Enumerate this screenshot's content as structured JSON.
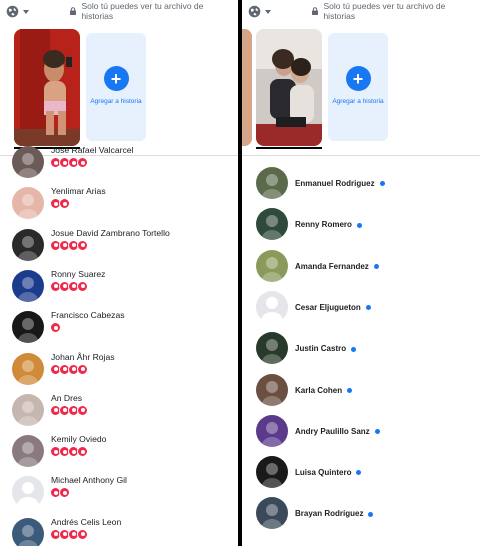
{
  "privacy_text": "Solo tú puedes ver tu archivo de historias",
  "add_story_label": "Agregar a historia",
  "colors": {
    "accent": "#1877f2",
    "reaction": "#f02849"
  },
  "left": {
    "viewers": [
      {
        "name": "Jose Rafael Valcarcel",
        "reactions": 4
      },
      {
        "name": "Yenlimar Arias",
        "reactions": 2
      },
      {
        "name": "Josue David Zambrano Tortello",
        "reactions": 4
      },
      {
        "name": "Ronny Suarez",
        "reactions": 4
      },
      {
        "name": "Francisco Cabezas",
        "reactions": 1
      },
      {
        "name": "Johan Åhr Rojas",
        "reactions": 4
      },
      {
        "name": "An Dres",
        "reactions": 4
      },
      {
        "name": "Kemily Oviedo",
        "reactions": 4
      },
      {
        "name": "Michael Anthony Gil",
        "reactions": 2
      },
      {
        "name": "Andrés Celis Leon",
        "reactions": 4
      }
    ]
  },
  "right": {
    "viewers": [
      {
        "name": "Enmanuel Rodriguez"
      },
      {
        "name": "Renny Romero"
      },
      {
        "name": "Amanda Fernandez"
      },
      {
        "name": "Cesar Eljugueton"
      },
      {
        "name": "Justin Castro"
      },
      {
        "name": "Karla Cohen"
      },
      {
        "name": "Andry Paulillo Sanz"
      },
      {
        "name": "Luisa Quintero"
      },
      {
        "name": "Brayan Rodríguez"
      }
    ]
  }
}
